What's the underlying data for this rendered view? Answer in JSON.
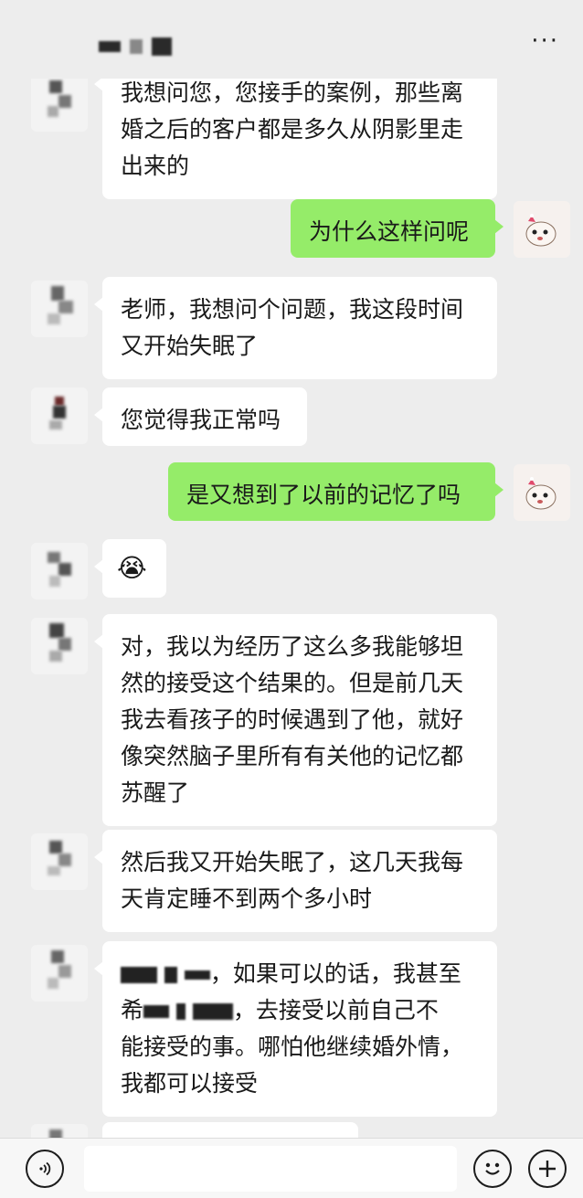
{
  "header": {
    "more_label": "···"
  },
  "messages": [
    {
      "side": "left",
      "lines": [
        "我想问您，您接手的案例，那些离",
        "婚之后的客户都是多久从阴影里走",
        "出来的"
      ]
    },
    {
      "side": "right",
      "lines": [
        "为什么这样问呢"
      ]
    },
    {
      "side": "left",
      "lines": [
        "老师，我想问个问题，我这段时间",
        "又开始失眠了"
      ]
    },
    {
      "side": "left",
      "lines": [
        "您觉得我正常吗"
      ]
    },
    {
      "side": "right",
      "lines": [
        "是又想到了以前的记忆了吗"
      ]
    },
    {
      "side": "left",
      "emoji": "😭"
    },
    {
      "side": "left",
      "lines": [
        "对，我以为经历了这么多我能够坦",
        "然的接受这个结果的。但是前几天",
        "我去看孩子的时候遇到了他，就好",
        "像突然脑子里所有有关他的记忆都",
        "苏醒了"
      ]
    },
    {
      "side": "left",
      "lines": [
        "然后我又开始失眠了，这几天我每",
        "天肯定睡不到两个多小时"
      ]
    },
    {
      "side": "left",
      "lines_partial": [
        {
          "after": "，如果可以的话，我甚至"
        },
        {
          "before": "希",
          "after": "，去接受以前自己不"
        },
        {
          "text": "能接受的事。哪怕他继续婚外情，"
        },
        {
          "text": "我都可以接受"
        }
      ]
    }
  ],
  "input_bar": {
    "voice_icon": "voice-icon",
    "emoji_icon": "emoji-icon",
    "plus_icon": "plus-icon"
  }
}
